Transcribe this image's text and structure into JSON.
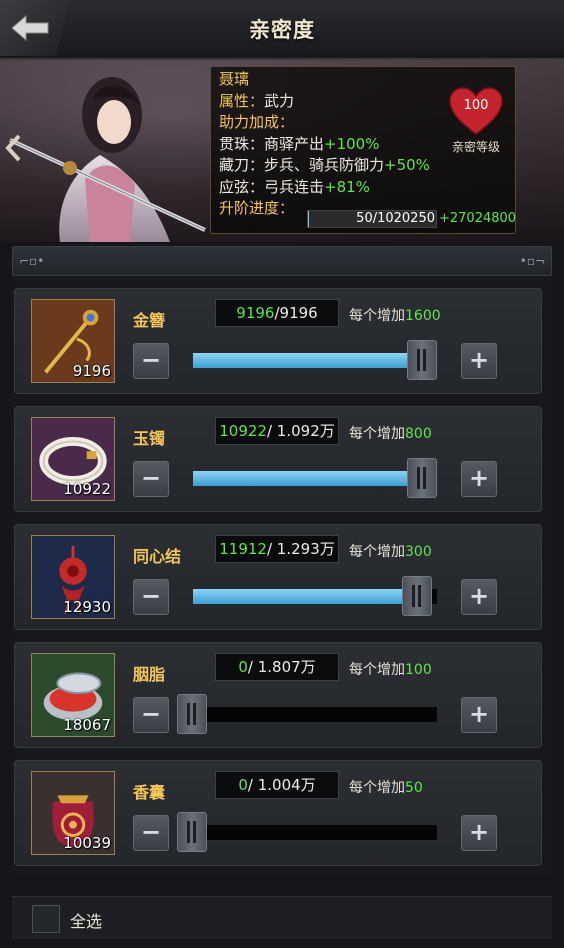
{
  "header": {
    "title": "亲密度"
  },
  "hero": {
    "name": "聂璃",
    "attribute_label": "属性：",
    "attribute_value": "武力",
    "bonus_title": "助力加成：",
    "bonuses": [
      {
        "item": "贯珠：",
        "text": "商驿产出",
        "value": "+100%"
      },
      {
        "item": "藏刀：",
        "text": "步兵、骑兵防御力",
        "value": "+50%"
      },
      {
        "item": "应弦：",
        "text": "弓兵连击",
        "value": "+81%"
      }
    ],
    "progress_label": "升阶进度：",
    "progress_text": "50/1020250",
    "progress_fraction": 5e-05,
    "progress_bonus": "+27024800",
    "intimacy_level": "100",
    "intimacy_label": "亲密等级"
  },
  "items": [
    {
      "name": "金簪",
      "count": "9196",
      "current": "9196",
      "max": "/9196",
      "per_label": "每个增加",
      "per_value": "1600",
      "fraction": 1.0,
      "icon": "hairpin-icon"
    },
    {
      "name": "玉镯",
      "count": "10922",
      "current": "10922",
      "max": "/ 1.092万",
      "per_label": "每个增加",
      "per_value": "800",
      "fraction": 1.0,
      "icon": "jade-bracelet-icon"
    },
    {
      "name": "同心结",
      "count": "12930",
      "current": "11912",
      "max": "/ 1.293万",
      "per_label": "每个增加",
      "per_value": "300",
      "fraction": 0.92,
      "icon": "knot-icon"
    },
    {
      "name": "胭脂",
      "count": "18067",
      "current": "0",
      "max": "/ 1.807万",
      "per_label": "每个增加",
      "per_value": "100",
      "fraction": 0.0,
      "icon": "rouge-icon"
    },
    {
      "name": "香囊",
      "count": "10039",
      "current": "0",
      "max": "/ 1.004万",
      "per_label": "每个增加",
      "per_value": "50",
      "fraction": 0.0,
      "icon": "sachet-icon"
    }
  ],
  "buttons": {
    "minus": "−",
    "plus": "+"
  },
  "footer": {
    "select_all": "全选"
  },
  "colors": {
    "gold": "#f3c65a",
    "green": "#5fe64a",
    "slider": "#5ab8e8"
  }
}
